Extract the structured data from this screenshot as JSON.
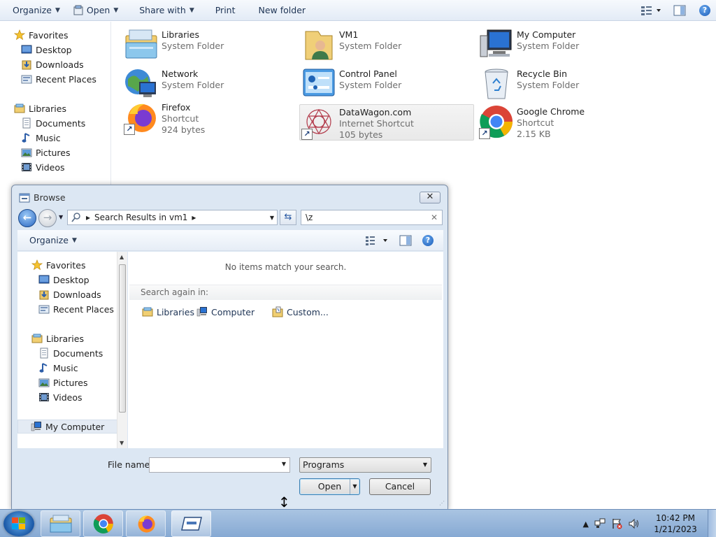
{
  "explorer": {
    "toolbar": {
      "organize": "Organize",
      "open": "Open",
      "share_with": "Share with",
      "print": "Print",
      "new_folder": "New folder"
    },
    "nav": {
      "favorites": "Favorites",
      "desktop": "Desktop",
      "downloads": "Downloads",
      "recent_places": "Recent Places",
      "libraries": "Libraries",
      "documents": "Documents",
      "music": "Music",
      "pictures": "Pictures",
      "videos": "Videos"
    },
    "items": [
      {
        "name": "Libraries",
        "type": "System Folder",
        "size": "",
        "icon": "libraries-icon"
      },
      {
        "name": "VM1",
        "type": "System Folder",
        "size": "",
        "icon": "user-folder-icon"
      },
      {
        "name": "My Computer",
        "type": "System Folder",
        "size": "",
        "icon": "computer-icon"
      },
      {
        "name": "Network",
        "type": "System Folder",
        "size": "",
        "icon": "network-icon"
      },
      {
        "name": "Control Panel",
        "type": "System Folder",
        "size": "",
        "icon": "control-panel-icon"
      },
      {
        "name": "Recycle Bin",
        "type": "System Folder",
        "size": "",
        "icon": "recycle-bin-icon"
      },
      {
        "name": "Firefox",
        "type": "Shortcut",
        "size": "924 bytes",
        "icon": "firefox-icon"
      },
      {
        "name": "DataWagon.com",
        "type": "Internet Shortcut",
        "size": "105 bytes",
        "icon": "datawagon-icon"
      },
      {
        "name": "Google Chrome",
        "type": "Shortcut",
        "size": "2.15 KB",
        "icon": "chrome-icon"
      }
    ]
  },
  "dialog": {
    "title": "Browse",
    "address": "Search Results in vm1",
    "search_value": "\\z",
    "organize": "Organize",
    "nav": {
      "favorites": "Favorites",
      "desktop": "Desktop",
      "downloads": "Downloads",
      "recent_places": "Recent Places",
      "libraries": "Libraries",
      "documents": "Documents",
      "music": "Music",
      "pictures": "Pictures",
      "videos": "Videos",
      "my_computer": "My Computer"
    },
    "no_items": "No items match your search.",
    "search_again": "Search again in:",
    "search_again_links": {
      "libraries": "Libraries",
      "computer": "Computer",
      "custom": "Custom..."
    },
    "file_name_label": "File name:",
    "file_name_value": "",
    "file_type": "Programs",
    "open_button": "Open",
    "cancel_button": "Cancel"
  },
  "taskbar": {
    "time": "10:42 PM",
    "date": "1/21/2023",
    "pinned": [
      "file-explorer-icon",
      "chrome-icon",
      "firefox-icon",
      "run-dialog-icon"
    ]
  },
  "colors": {
    "accent": "#1a5cb8",
    "taskbar": "#93b3da",
    "dialog_frame": "#dce7f3"
  }
}
